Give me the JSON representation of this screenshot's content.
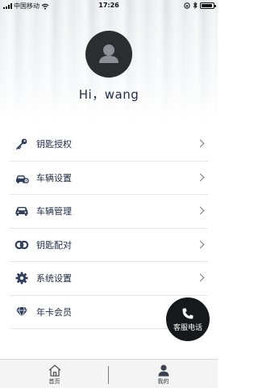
{
  "status_bar": {
    "carrier": "中国移动",
    "time": "17:26"
  },
  "profile": {
    "greeting": "Hi，wang"
  },
  "menu": {
    "items": [
      {
        "label": "钥匙授权",
        "icon": "key-icon"
      },
      {
        "label": "车辆设置",
        "icon": "car-settings-icon"
      },
      {
        "label": "车辆管理",
        "icon": "car-icon"
      },
      {
        "label": "钥匙配对",
        "icon": "link-rings-icon"
      },
      {
        "label": "系统设置",
        "icon": "gear-icon"
      },
      {
        "label": "年卡会员",
        "icon": "diamond-icon"
      }
    ]
  },
  "service": {
    "label": "客服电话",
    "icon": "phone-icon"
  },
  "tabbar": {
    "tabs": [
      {
        "label": "首页",
        "icon": "home-icon"
      },
      {
        "label": "我的",
        "icon": "user-icon"
      }
    ]
  },
  "colors": {
    "text": "#1f2a44",
    "icon": "#2e3e5c",
    "avatar_bg": "#2b2d31",
    "service_bg": "#16181c",
    "tabbar_bg": "#f4f4f4"
  }
}
